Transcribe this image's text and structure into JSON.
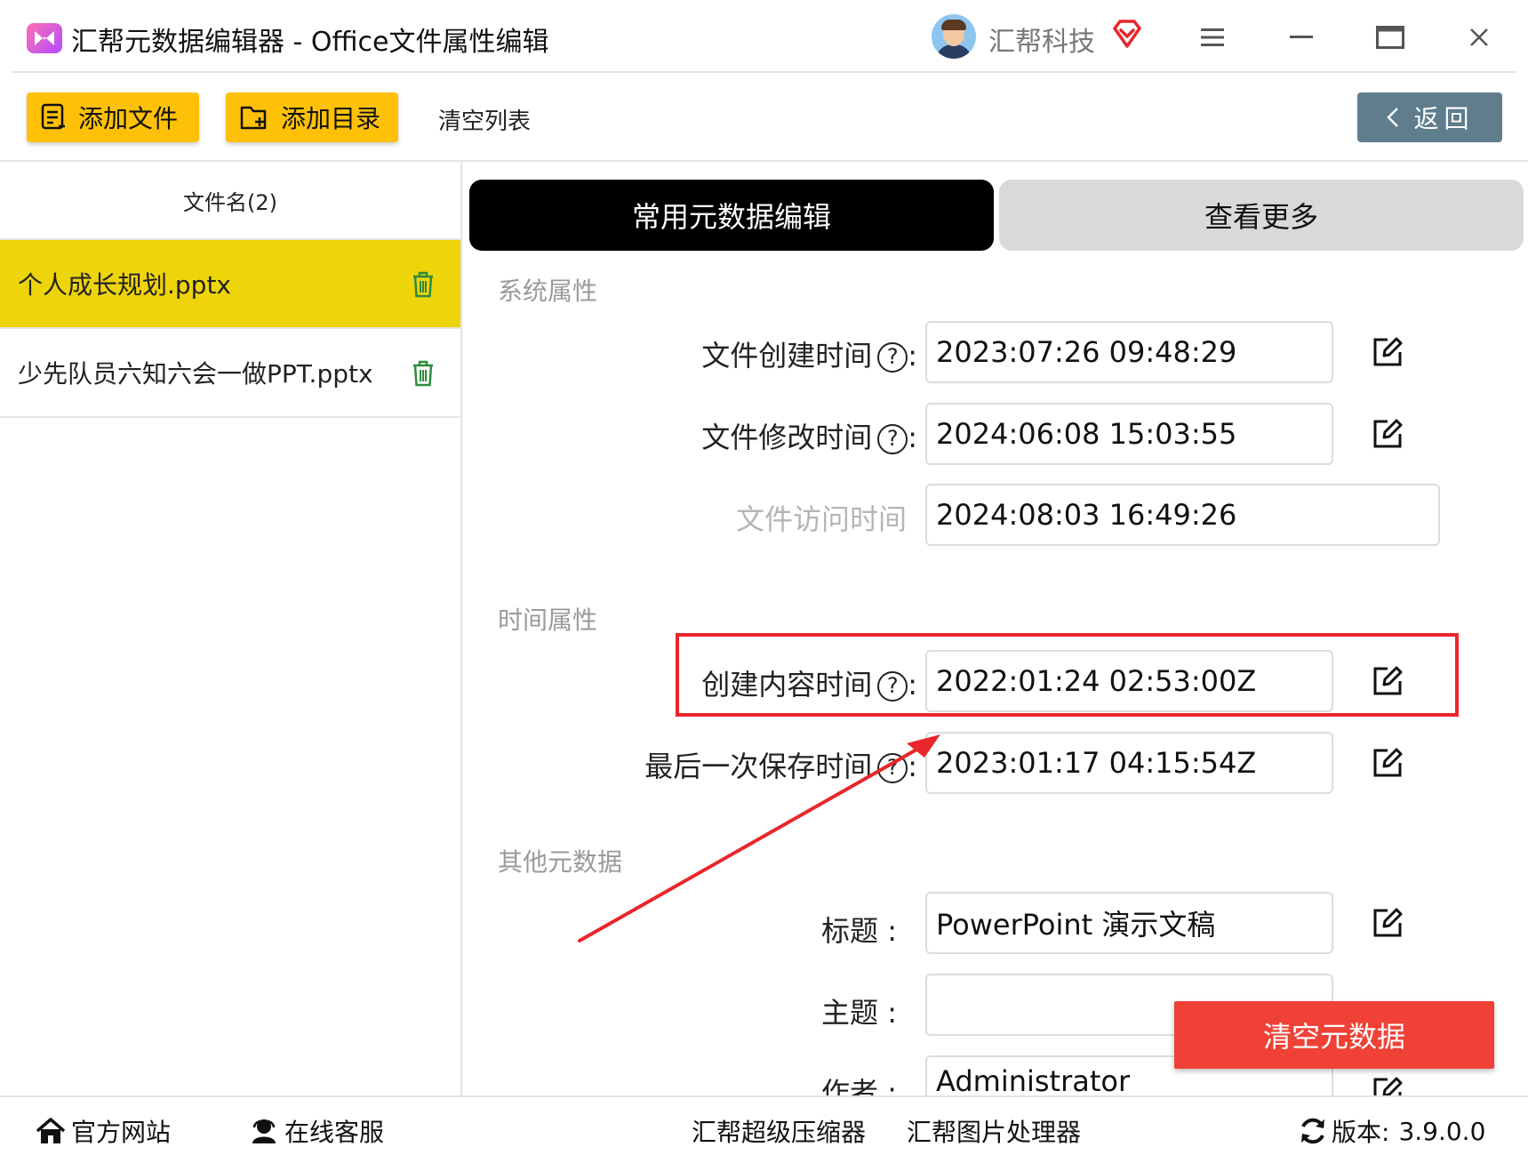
{
  "window": {
    "title": "汇帮元数据编辑器 - Office文件属性编辑",
    "company": "汇帮科技"
  },
  "toolbar": {
    "add_file": "添加文件",
    "add_folder": "添加目录",
    "clear_list": "清空列表",
    "back": "返回"
  },
  "file_list": {
    "header": "文件名(2)",
    "items": [
      {
        "name": "个人成长规划.pptx",
        "selected": true
      },
      {
        "name": "少先队员六知六会一做PPT.pptx",
        "selected": false
      }
    ]
  },
  "tabs": {
    "common": "常用元数据编辑",
    "more": "查看更多"
  },
  "sections": {
    "system": "系统属性",
    "time": "时间属性",
    "other": "其他元数据"
  },
  "fields": {
    "created": {
      "label": "文件创建时间",
      "value": "2023:07:26 09:48:29"
    },
    "modified": {
      "label": "文件修改时间",
      "value": "2024:06:08 15:03:55"
    },
    "accessed": {
      "label": "文件访问时间",
      "value": "2024:08:03 16:49:26"
    },
    "content_created": {
      "label": "创建内容时间",
      "value": "2022:01:24 02:53:00Z"
    },
    "last_saved": {
      "label": "最后一次保存时间",
      "value": "2023:01:17 04:15:54Z"
    },
    "title": {
      "label": "标题",
      "value": "PowerPoint 演示文稿"
    },
    "subject": {
      "label": "主题",
      "value": ""
    },
    "author": {
      "label": "作者",
      "value": "Administrator"
    }
  },
  "actions": {
    "clear_metadata": "清空元数据"
  },
  "footer": {
    "website": "官方网站",
    "support": "在线客服",
    "compressor": "汇帮超级压缩器",
    "image_tool": "汇帮图片处理器",
    "version_label": "版本:",
    "version": "3.9.0.0"
  },
  "colors": {
    "accent_yellow": "#ffc107",
    "selected_row": "#edd40b",
    "danger": "#ef4136",
    "highlight": "#e8262b",
    "back_button": "#5f7d8c"
  }
}
